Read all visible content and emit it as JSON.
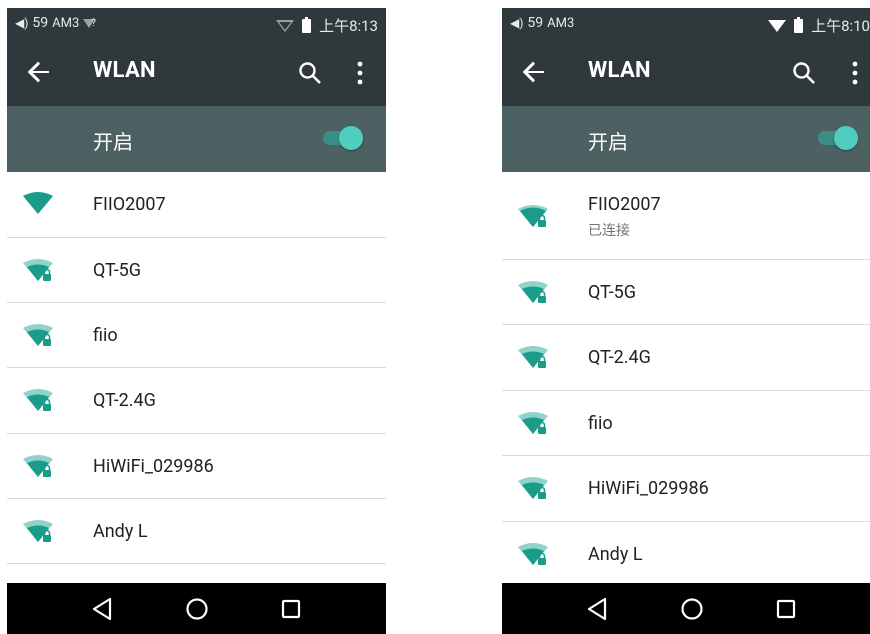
{
  "left": {
    "status": {
      "volume": "59",
      "network": "AM3",
      "wifi_unknown": "?",
      "time": "上午8:13"
    },
    "appbar": {
      "title": "WLAN",
      "icons": [
        "back-arrow-icon",
        "search-icon",
        "overflow-menu-icon"
      ]
    },
    "wlan_switch": {
      "label": "开启",
      "state": "on"
    },
    "networks": [
      {
        "ssid": "FIIO2007",
        "secured": false,
        "signal": "full"
      },
      {
        "ssid": "QT-5G",
        "secured": true,
        "signal": "strong"
      },
      {
        "ssid": "fiio",
        "secured": true,
        "signal": "strong"
      },
      {
        "ssid": "QT-2.4G",
        "secured": true,
        "signal": "strong"
      },
      {
        "ssid": "HiWiFi_029986",
        "secured": true,
        "signal": "strong"
      },
      {
        "ssid": "Andy L",
        "secured": true,
        "signal": "strong"
      }
    ],
    "navbar": {
      "icons": [
        "back-triangle-icon",
        "home-circle-icon",
        "recents-square-icon"
      ]
    }
  },
  "right": {
    "status": {
      "volume": "59",
      "network": "AM3",
      "time": "上午8:10"
    },
    "appbar": {
      "title": "WLAN",
      "icons": [
        "back-arrow-icon",
        "search-icon",
        "overflow-menu-icon"
      ]
    },
    "wlan_switch": {
      "label": "开启",
      "state": "on"
    },
    "networks": [
      {
        "ssid": "FIIO2007",
        "status": "已连接",
        "secured": true,
        "signal": "strong"
      },
      {
        "ssid": "QT-5G",
        "secured": true,
        "signal": "strong"
      },
      {
        "ssid": "QT-2.4G",
        "secured": true,
        "signal": "strong"
      },
      {
        "ssid": "fiio",
        "secured": true,
        "signal": "strong"
      },
      {
        "ssid": "HiWiFi_029986",
        "secured": true,
        "signal": "strong"
      },
      {
        "ssid": "Andy L",
        "secured": true,
        "signal": "strong"
      }
    ],
    "navbar": {
      "icons": [
        "back-triangle-icon",
        "home-circle-icon",
        "recents-square-icon"
      ]
    }
  },
  "colors": {
    "accent": "#1b9c8b",
    "toolbar": "#2f383a",
    "switchbar": "#4d6163",
    "toggle_thumb": "#4fcdbe"
  }
}
